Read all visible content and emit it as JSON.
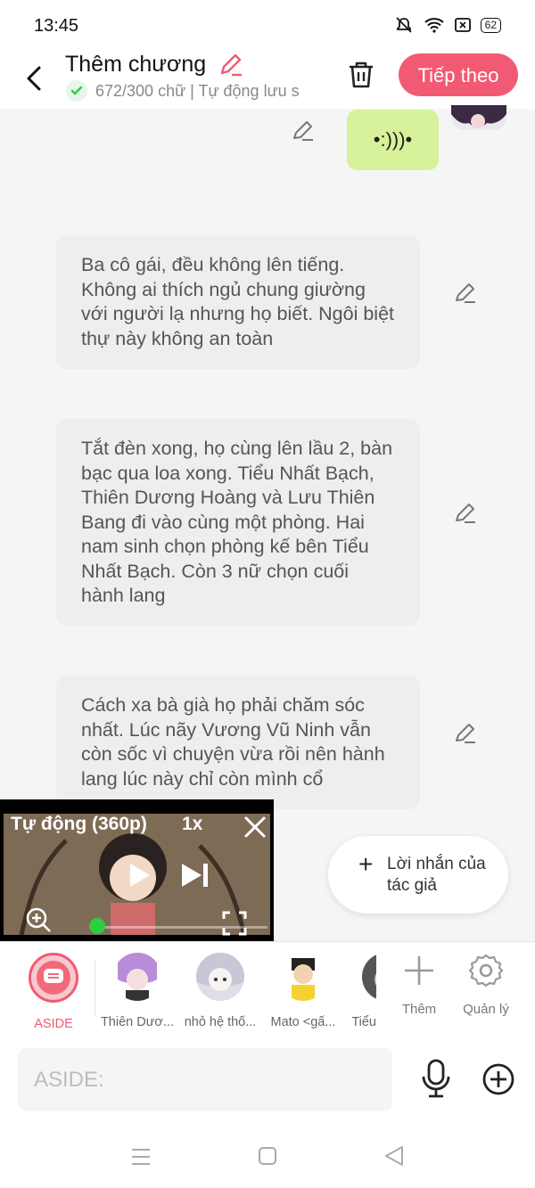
{
  "status": {
    "time": "13:45",
    "battery": "62"
  },
  "header": {
    "title": "Thêm chương",
    "subtitle": "672/300 chữ | Tự động lưu s",
    "next_label": "Tiếp theo"
  },
  "voice": {
    "wave": "•:)))•"
  },
  "messages": [
    "Ba cô gái, đều không lên tiếng. Không ai thích ngủ chung giường với người lạ nhưng họ biết. Ngôi biệt thự này không an toàn",
    "Tắt đèn xong, họ cùng lên lầu 2, bàn bạc qua loa xong. Tiểu Nhất Bạch, Thiên Dương Hoàng và Lưu Thiên Bang đi vào cùng một phòng. Hai nam sinh chọn phòng kế bên Tiểu Nhất Bạch. Còn 3 nữ chọn cuối hành lang",
    "Cách xa bà già họ phải chăm sóc nhất. Lúc nãy Vương Vũ Ninh vẫn còn sốc vì chuyện vừa rồi nên hành lang lúc này chỉ còn mình cổ"
  ],
  "video": {
    "quality": "Tự động (360p)",
    "speed": "1x"
  },
  "author_note": {
    "label": "Lời nhắn của tác giả"
  },
  "characters": {
    "aside": "ASIDE",
    "items": [
      "Thiên Dươ...",
      "nhỏ hệ thố...",
      "Mato <gấ...",
      "Tiểu"
    ],
    "add_label": "Thêm",
    "manage_label": "Quản lý"
  },
  "input": {
    "placeholder": "ASIDE:"
  },
  "colors": {
    "accent": "#f25a73",
    "voice_bubble": "#d7f29a",
    "progress": "#2ecc40"
  }
}
